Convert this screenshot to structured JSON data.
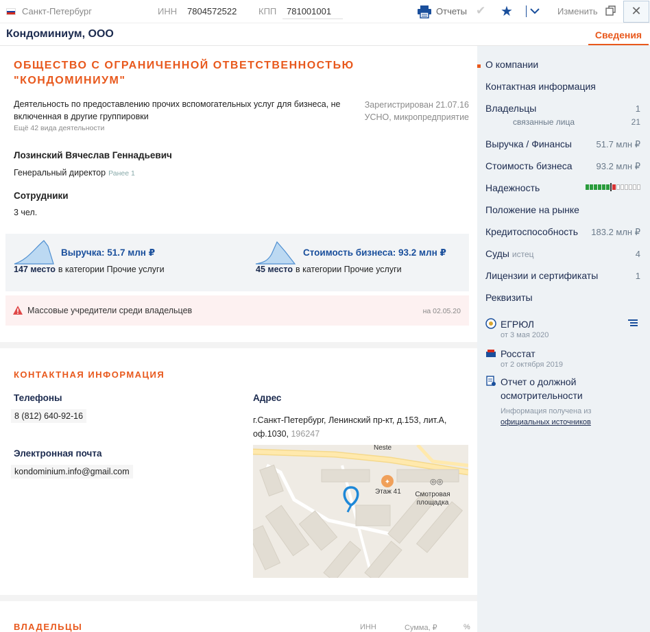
{
  "topbar": {
    "city": "Санкт-Петербург",
    "inn_label": "ИНН",
    "inn_value": "7804572522",
    "kpp_label": "КПП",
    "kpp_value": "781001001",
    "reports_label": "Отчеты",
    "edit_label": "Изменить",
    "flag_colors": [
      "#ffffff",
      "#1c3f9e",
      "#d52b1e"
    ],
    "icons": [
      "printer-icon",
      "check-icon",
      "star-icon",
      "chevron-down-icon",
      "copy-icon",
      "close-icon"
    ]
  },
  "header": {
    "company_short": "Кондоминиум, ООО",
    "active_tab": "Сведения"
  },
  "overview": {
    "full_name": "ОБЩЕСТВО С ОГРАНИЧЕННОЙ ОТВЕТСТВЕННОСТЬЮ \"КОНДОМИНИУМ\"",
    "activity": "Деятельность по предоставлению прочих вспомогательных услуг для бизнеса, не включенная в другие группировки",
    "more_activities": "Ещё 42 вида деятельности",
    "registered": "Зарегистрирован 21.07.16",
    "tax_mode": "УСНО, микропредприятие",
    "director_name": "Лозинский Вячеслав Геннадьевич",
    "director_position": "Генеральный директор",
    "director_earlier": "Ранее 1",
    "employees_label": "Сотрудники",
    "employees_value": "3 чел."
  },
  "stats": {
    "revenue_title": "Выручка: 51.7 млн ₽",
    "revenue_rank": "147 место",
    "revenue_category": "в категории Прочие услуги",
    "value_title": "Стоимость бизнеса: 93.2 млн ₽",
    "value_rank": "45 место",
    "value_category": "в категории Прочие услуги"
  },
  "warning": {
    "text": "Массовые учредители среди владельцев",
    "date": "на 02.05.20"
  },
  "contacts": {
    "section_title": "КОНТАКТНАЯ ИНФОРМАЦИЯ",
    "phones_label": "Телефоны",
    "phone": "8 (812) 640-92-16",
    "email_label": "Электронная почта",
    "email": "kondominium.info@gmail.com",
    "address_label": "Адрес",
    "address": "г.Санкт-Петербург, Ленинский пр-кт, д.153, лит.А, оф.1030,",
    "zip": "196247",
    "map_labels": {
      "station": "Neste",
      "restaurant": "Этаж 41",
      "viewpoint": "Смотровая площадка"
    }
  },
  "owners": {
    "section_title": "ВЛАДЕЛЬЦЫ",
    "col_inn": "ИНН",
    "col_sum": "Сумма, ₽",
    "col_pct": "%"
  },
  "sidebar": {
    "nav": [
      {
        "label": "О компании",
        "value": ""
      },
      {
        "label": "Контактная информация",
        "value": ""
      },
      {
        "label": "Владельцы",
        "value": "1"
      },
      {
        "label": "связанные лица",
        "value": "21"
      },
      {
        "label": "Выручка / Финансы",
        "value": "51.7 млн ₽"
      },
      {
        "label": "Стоимость бизнеса",
        "value": "93.2 млн ₽"
      },
      {
        "label": "Надежность",
        "value": ""
      },
      {
        "label": "Положение на рынке",
        "value": ""
      },
      {
        "label": "Кредитоспособность",
        "value": "183.2 млн ₽"
      },
      {
        "label": "Суды",
        "sub": "истец",
        "value": "4"
      },
      {
        "label": "Лицензии и сертификаты",
        "value": "1"
      },
      {
        "label": "Реквизиты",
        "value": ""
      }
    ],
    "reliability_level": {
      "green": 6,
      "red": 1,
      "empty": 6
    },
    "sources": [
      {
        "name": "ЕГРЮЛ",
        "date": "от 3 мая 2020",
        "icon": "egrul-emblem-icon"
      },
      {
        "name": "Росстат",
        "date": "от 2 октября 2019",
        "icon": "rosstat-icon"
      },
      {
        "name": "Отчет о должной осмотрительности",
        "date": "",
        "icon": "document-icon"
      }
    ],
    "info_note_1": "Информация получена из",
    "info_note_2": "официальных источников"
  },
  "colors": {
    "accent": "#e8581c",
    "brand": "#1a4f9c",
    "nav_text": "#1b2a4e"
  }
}
